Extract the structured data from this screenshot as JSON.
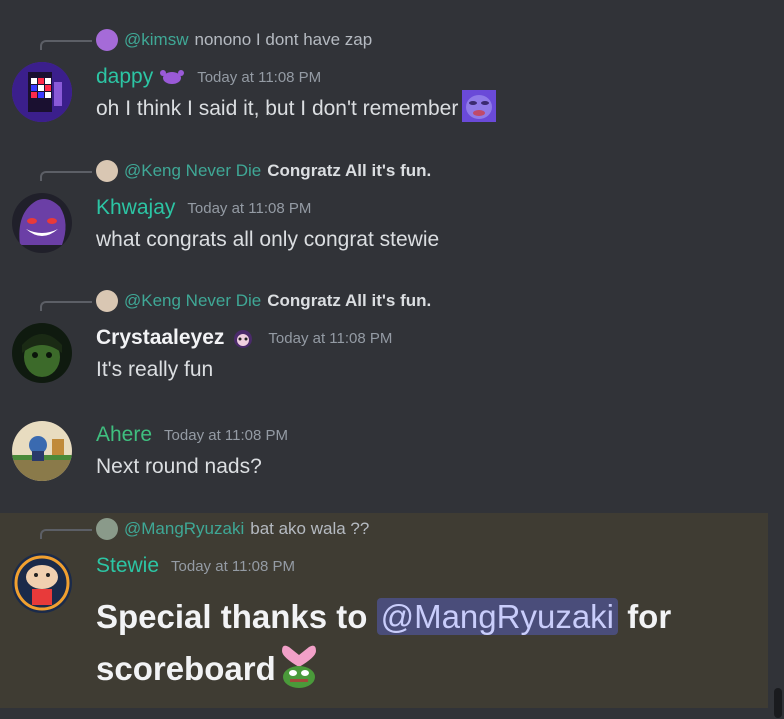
{
  "messages": [
    {
      "reply": {
        "name": "@kimsw",
        "text": "nonono I dont have zap"
      },
      "user": "dappy",
      "timestamp": "Today at 11:08 PM",
      "text": "oh I think I said it, but I don't remember"
    },
    {
      "reply": {
        "name": "@Keng Never Die",
        "text": "Congratz All it's fun."
      },
      "user": "Khwajay",
      "timestamp": "Today at 11:08 PM",
      "text": "what congrats all only congrat stewie"
    },
    {
      "reply": {
        "name": "@Keng Never Die",
        "text": "Congratz All it's fun."
      },
      "user": "Crystaaleyez",
      "timestamp": "Today at 11:08 PM",
      "text": "It's really fun"
    },
    {
      "user": "Ahere",
      "timestamp": "Today at 11:08 PM",
      "text": "Next round nads?"
    },
    {
      "reply": {
        "name": "@MangRyuzaki",
        "text": "bat ako wala ??"
      },
      "user": "Stewie",
      "timestamp": "Today at 11:08 PM",
      "text_before": "Special thanks to",
      "mention": "@MangRyuzaki",
      "text_after": "for",
      "text_line2": "scoreboard"
    }
  ],
  "colors": {
    "background": "#313338",
    "highlight": "#3f3c33",
    "name_teal": "#2cc5a4",
    "mention_bg": "#4a4d7a"
  }
}
